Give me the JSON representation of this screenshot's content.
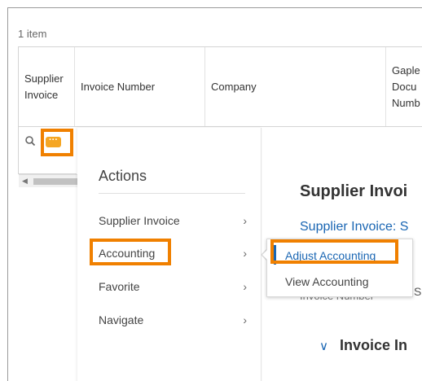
{
  "grid": {
    "item_count": "1 item",
    "columns": [
      {
        "label": "Supplier Invoice"
      },
      {
        "label": "Invoice Number"
      },
      {
        "label": "Company"
      },
      {
        "label": "Gaple Docu Numb"
      }
    ]
  },
  "row": {
    "more_label": "···"
  },
  "actions_menu": {
    "title": "Actions",
    "items": [
      {
        "label": "Supplier Invoice",
        "chevron": "›"
      },
      {
        "label": "Accounting",
        "chevron": "›"
      },
      {
        "label": "Favorite",
        "chevron": "›"
      },
      {
        "label": "Navigate",
        "chevron": "›"
      }
    ]
  },
  "submenu": {
    "items": [
      {
        "label": "Adjust Accounting"
      },
      {
        "label": "View Accounting"
      }
    ]
  },
  "background": {
    "title": "Supplier Invoi",
    "link": "Supplier Invoice: S",
    "partial_label": "Invoice Number",
    "partial_s": "S",
    "section": "Invoice In",
    "section_chevron": "∨"
  },
  "colors": {
    "highlight": "#f08000",
    "link": "#1a66b3",
    "more_button": "#f5a623"
  },
  "icons": {
    "search": "search-icon",
    "more": "more-horizontal-icon",
    "chevron": "chevron-right-icon"
  }
}
